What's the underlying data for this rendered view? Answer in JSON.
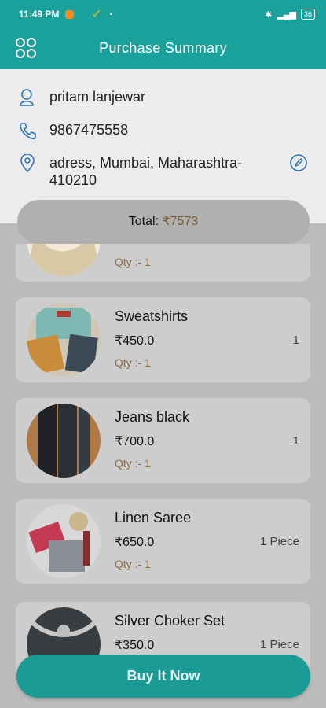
{
  "status_bar": {
    "time": "11:49 PM",
    "battery": "36"
  },
  "app_bar": {
    "title": "Purchase Summary",
    "menu_icon": "grid-menu-icon"
  },
  "customer": {
    "name": "pritam lanjewar",
    "phone": "9867475558",
    "address_line1": "adress, Mumbai, Maharashtra-",
    "address_line2": "410210"
  },
  "total": {
    "label": "Total: ",
    "currency": "₹",
    "amount": "7573"
  },
  "items": [
    {
      "name": "",
      "price": "",
      "qty": "Qty :- 1",
      "unit": ""
    },
    {
      "name": "Sweatshirts",
      "price": "₹450.0",
      "qty": "Qty :- 1",
      "unit": "1"
    },
    {
      "name": "Jeans black",
      "price": "₹700.0",
      "qty": "Qty :- 1",
      "unit": "1"
    },
    {
      "name": "Linen Saree",
      "price": "₹650.0",
      "qty": "Qty :- 1",
      "unit": "1 Piece"
    },
    {
      "name": "Silver Choker Set",
      "price": "₹350.0",
      "qty": "",
      "unit": "1 Piece"
    }
  ],
  "buy_button": {
    "label": "Buy It Now"
  },
  "colors": {
    "accent": "#1aa19b",
    "qty_text": "#8a6a40"
  }
}
